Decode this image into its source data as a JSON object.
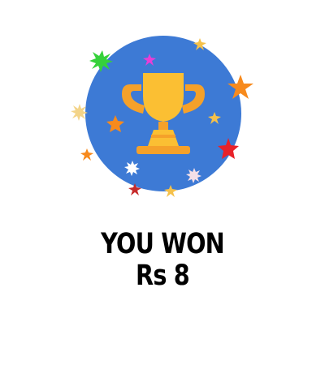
{
  "reward": {
    "headline": "YOU WON",
    "amount": "Rs 8"
  },
  "colors": {
    "badge_blue": "#3d7ad5",
    "trophy_gold": "#fbbf33",
    "trophy_orange": "#f5a12a",
    "star_orange": "#f78a1d",
    "star_red": "#e8222a",
    "star_green": "#35d13a",
    "star_magenta": "#e83ed6",
    "text": "#000000"
  },
  "icons": {
    "trophy": "trophy-icon",
    "stars": "star-icon"
  }
}
